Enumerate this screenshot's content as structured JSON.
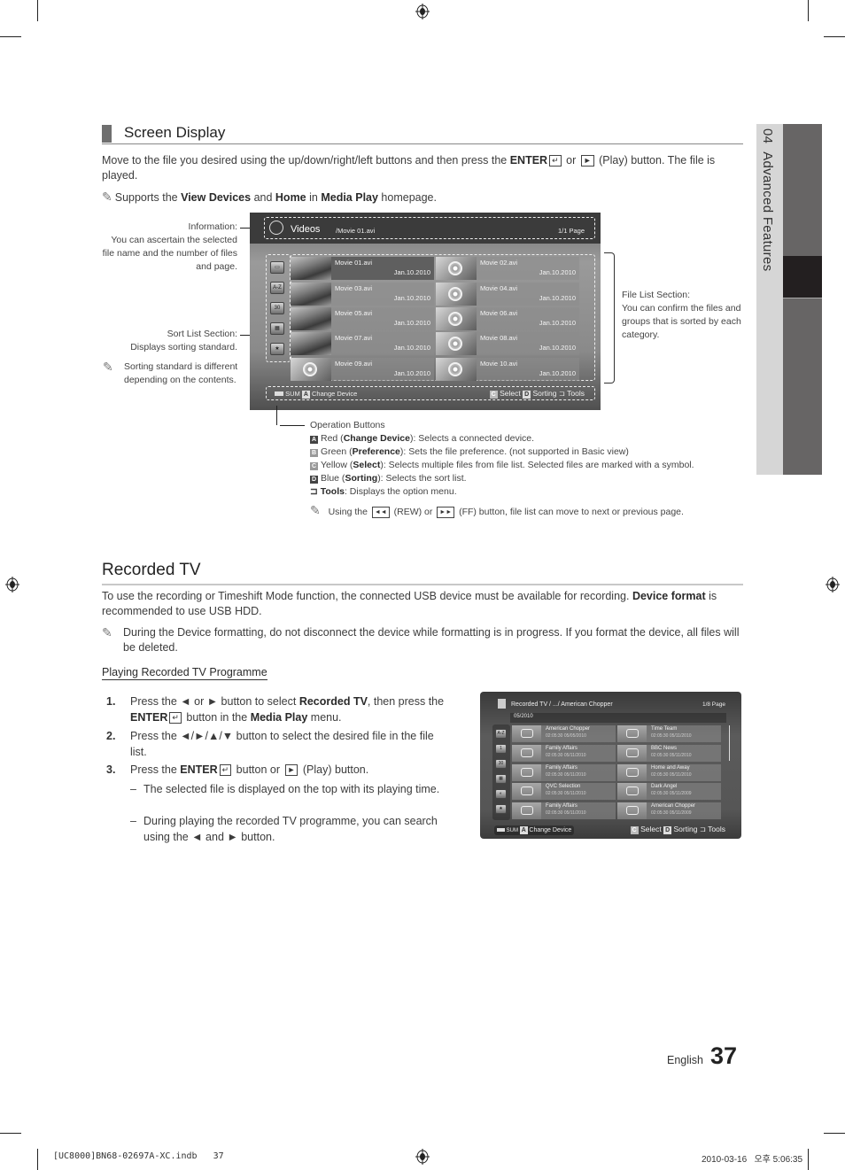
{
  "section1": {
    "title": "Screen Display",
    "intro_pre": "Move to the file you desired using the up/down/right/left buttons and then press the ",
    "intro_enter": "ENTER",
    "intro_mid": " or ",
    "intro_post": " (Play) button. The file is played.",
    "note_pre": "Supports the ",
    "note_b1": "View Devices",
    "note_and": " and ",
    "note_b2": "Home",
    "note_in": " in ",
    "note_b3": "Media Play",
    "note_post": " homepage."
  },
  "side_tab": {
    "chapter": "04",
    "label": "Advanced Features"
  },
  "annotations": {
    "information_title": "Information:",
    "information_body": "You can ascertain the selected file name and the number of files and page.",
    "sort_title": "Sort List Section:",
    "sort_body": "Displays sorting standard.",
    "sort_note": "Sorting standard is different depending on the contents.",
    "filelist_title": "File List Section:",
    "filelist_body": "You can confirm the files and groups that is sorted by each category.",
    "ops_title": "Operation Buttons",
    "ops": [
      {
        "key": "A",
        "color": "Red",
        "name": "Change Device",
        "desc": ": Selects a connected device."
      },
      {
        "key": "B",
        "color": "Green",
        "name": "Preference",
        "desc": ": Sets the file preference. (not supported in Basic view)"
      },
      {
        "key": "C",
        "color": "Yellow",
        "name": "Select",
        "desc": ": Selects multiple files from file list. Selected files are marked with a symbol."
      },
      {
        "key": "D",
        "color": "Blue",
        "name": "Sorting",
        "desc": ": Selects the sort list."
      }
    ],
    "tools_name": "Tools",
    "tools_desc": ": Displays the option menu.",
    "rew_note_pre": "Using the ",
    "rew_note_mid": " (REW) or ",
    "rew_note_post": " (FF) button, file list can move to next or previous page."
  },
  "tv_videos": {
    "category": "Videos",
    "path": "/Movie 01.avi",
    "page": "1/1 Page",
    "files": [
      {
        "name": "Movie 01.avi",
        "date": "Jan.10.2010",
        "thumb": "photo",
        "selected": true
      },
      {
        "name": "Movie 02.avi",
        "date": "Jan.10.2010",
        "thumb": "reel"
      },
      {
        "name": "Movie 03.avi",
        "date": "Jan.10.2010",
        "thumb": "photo"
      },
      {
        "name": "Movie 04.avi",
        "date": "Jan.10.2010",
        "thumb": "reel"
      },
      {
        "name": "Movie 05.avi",
        "date": "Jan.10.2010",
        "thumb": "photo"
      },
      {
        "name": "Movie 06.avi",
        "date": "Jan.10.2010",
        "thumb": "reel"
      },
      {
        "name": "Movie 07.avi",
        "date": "Jan.10.2010",
        "thumb": "photo"
      },
      {
        "name": "Movie 08.avi",
        "date": "Jan.10.2010",
        "thumb": "reel"
      },
      {
        "name": "Movie 09.avi",
        "date": "Jan.10.2010",
        "thumb": "reel"
      },
      {
        "name": "Movie 10.avi",
        "date": "Jan.10.2010",
        "thumb": "reel"
      }
    ],
    "sort_icons": [
      "folder",
      "A-Z",
      "30",
      "calendar",
      "star"
    ],
    "bottom": {
      "sum": "SUM",
      "a_key": "A",
      "change_device": "Change Device",
      "c_key": "C",
      "select": "Select",
      "d_key": "D",
      "sorting": "Sorting",
      "tools": "Tools"
    }
  },
  "section2": {
    "title": "Recorded TV",
    "intro_pre": "To use the recording or Timeshift Mode function, the connected USB device must be available for recording. ",
    "intro_bold": "Device format",
    "intro_post": " is recommended to use USB HDD.",
    "note": "During the Device formatting, do not disconnect the device while formatting is in progress. If you format the device, all files will be deleted.",
    "subheading": "Playing Recorded TV Programme",
    "steps": [
      {
        "num": "1.",
        "pre": "Press the ◄ or ► button to select ",
        "b1": "Recorded TV",
        "mid": ", then press the ",
        "b2": "ENTER",
        "mid2": " button in the ",
        "b3": "Media Play",
        "post": " menu."
      },
      {
        "num": "2.",
        "text": "Press the ◄/►/▲/▼ button to select the desired file in the file list."
      },
      {
        "num": "3.",
        "pre": "Press the ",
        "b1": "ENTER",
        "mid": " button or ",
        "post": " (Play) button."
      }
    ],
    "subpoints": [
      "The selected file is displayed on the top with its playing time.",
      "During playing the recorded TV programme, you can search using the ◄ and ► button."
    ]
  },
  "tv_recorded": {
    "path": "Recorded TV / .../ American Chopper",
    "page": "1/8 Page",
    "group": "05/2010",
    "items": [
      {
        "name": "American Chopper",
        "info": "02:05:30  05/05/2010"
      },
      {
        "name": "Time Team",
        "info": "02:05:30  05/11/2010"
      },
      {
        "name": "Family Affairs",
        "info": "02:05:30  05/11/2010"
      },
      {
        "name": "BBC News",
        "info": "02:05:30  05/11/2010"
      },
      {
        "name": "Family Affairs",
        "info": "02:05:30  05/11/2010"
      },
      {
        "name": "Home and Away",
        "info": "02:05:30  05/11/2010"
      },
      {
        "name": "QVC Selection",
        "info": "02:05:30  05/11/2010"
      },
      {
        "name": "Dark Angel",
        "info": "02:05:30  05/11/2009"
      },
      {
        "name": "Family Affairs",
        "info": "02:05:30  05/11/2010"
      },
      {
        "name": "American Chopper",
        "info": "02:05:30  05/11/2009"
      }
    ],
    "bottom": {
      "sum": "SUM",
      "a_key": "A",
      "change_device": "Change Device",
      "c_key": "C",
      "select": "Select",
      "d_key": "D",
      "sorting": "Sorting",
      "tools": "Tools"
    }
  },
  "footer": {
    "language": "English",
    "page_number": "37",
    "file_info": "[UC8000]BN68-02697A-XC.indb   37",
    "timestamp": "2010-03-16   오후 5:06:35"
  },
  "colors": {
    "side_tab_light": "#d6d6d6",
    "side_tab_dark": "#676565",
    "side_tab_active": "#231f20",
    "heading_bar": "#6f6f6f"
  }
}
